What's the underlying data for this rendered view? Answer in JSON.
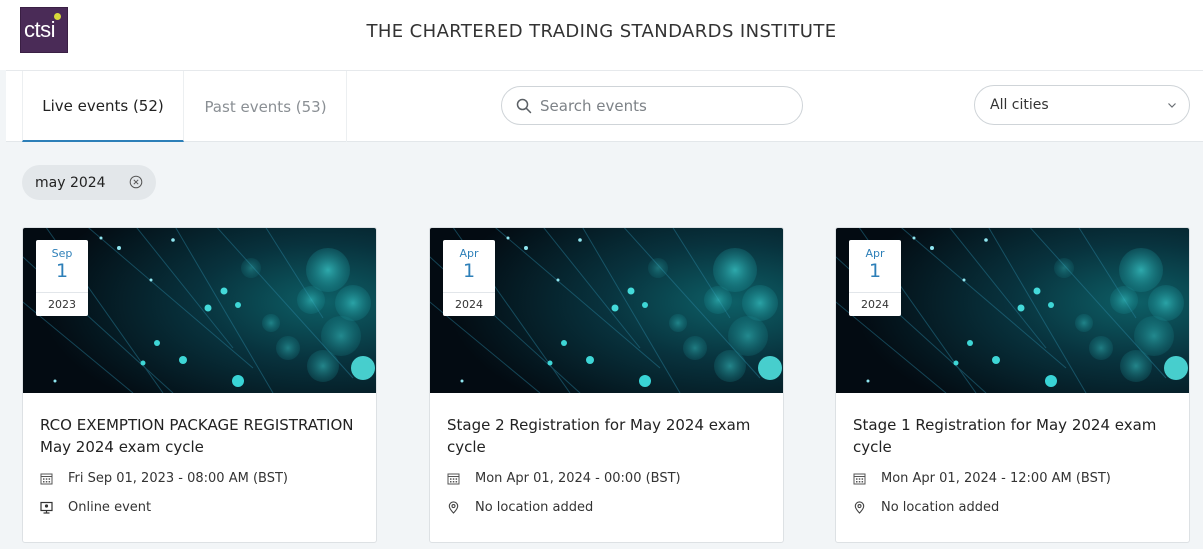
{
  "header": {
    "logo_text": "ctsi",
    "title": "THE CHARTERED TRADING STANDARDS INSTITUTE"
  },
  "tabs": [
    {
      "label": "Live events (52)",
      "active": true
    },
    {
      "label": "Past events (53)",
      "active": false
    }
  ],
  "search": {
    "placeholder": "Search events",
    "value": ""
  },
  "city_filter": {
    "selected": "All cities"
  },
  "active_filter": {
    "label": "may 2024"
  },
  "events": [
    {
      "month": "Sep",
      "day": "1",
      "year": "2023",
      "title": "RCO EXEMPTION PACKAGE REGISTRATION May 2024 exam cycle",
      "datetime": "Fri Sep 01, 2023 - 08:00 AM (BST)",
      "location": "Online event",
      "location_icon": "monitor-icon"
    },
    {
      "month": "Apr",
      "day": "1",
      "year": "2024",
      "title": "Stage 2 Registration for May 2024 exam cycle",
      "datetime": "Mon Apr 01, 2024 - 00:00 (BST)",
      "location": "No location added",
      "location_icon": "location-pin-icon"
    },
    {
      "month": "Apr",
      "day": "1",
      "year": "2024",
      "title": "Stage 1 Registration for May 2024 exam cycle",
      "datetime": "Mon Apr 01, 2024 - 12:00 AM (BST)",
      "location": "No location added",
      "location_icon": "location-pin-icon"
    }
  ],
  "colors": {
    "accent": "#2d7fb8",
    "logo_bg": "#4a2b57",
    "page_bg": "#f2f5f7",
    "image_glow": "#27c8cc"
  }
}
